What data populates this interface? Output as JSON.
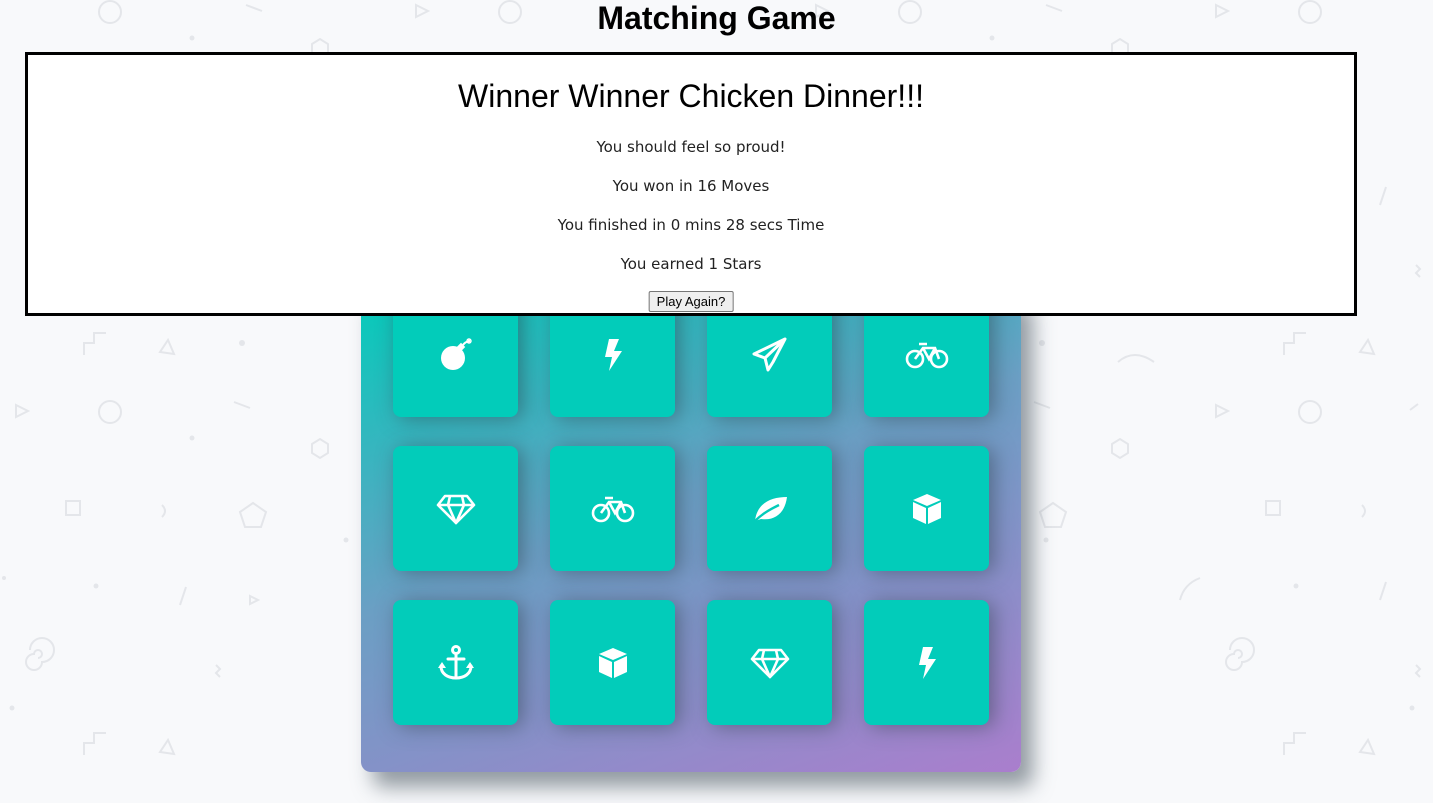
{
  "page": {
    "title": "Matching Game"
  },
  "modal": {
    "heading": "Winner Winner Chicken Dinner!!!",
    "proud": "You should feel so proud!",
    "moves": "You won in 16 Moves",
    "time": "You finished in 0 mins 28 secs Time",
    "stars": "You earned 1 Stars",
    "play_again": "Play Again?"
  },
  "deck": {
    "cards": [
      {
        "icon": "bomb-icon",
        "matched": true
      },
      {
        "icon": "bolt-icon",
        "matched": true
      },
      {
        "icon": "paper-plane-icon",
        "matched": true
      },
      {
        "icon": "bicycle-icon",
        "matched": true
      },
      {
        "icon": "diamond-icon",
        "matched": true
      },
      {
        "icon": "bicycle-icon",
        "matched": true
      },
      {
        "icon": "leaf-icon",
        "matched": true
      },
      {
        "icon": "cube-icon",
        "matched": true
      },
      {
        "icon": "anchor-icon",
        "matched": true
      },
      {
        "icon": "cube-icon",
        "matched": true
      },
      {
        "icon": "diamond-icon",
        "matched": true
      },
      {
        "icon": "bolt-icon",
        "matched": true
      }
    ]
  },
  "colors": {
    "card": "#02ccba",
    "deck_gradient_start": "#02ccba",
    "deck_gradient_end": "#aa7ecd",
    "modal_border": "#000000"
  }
}
